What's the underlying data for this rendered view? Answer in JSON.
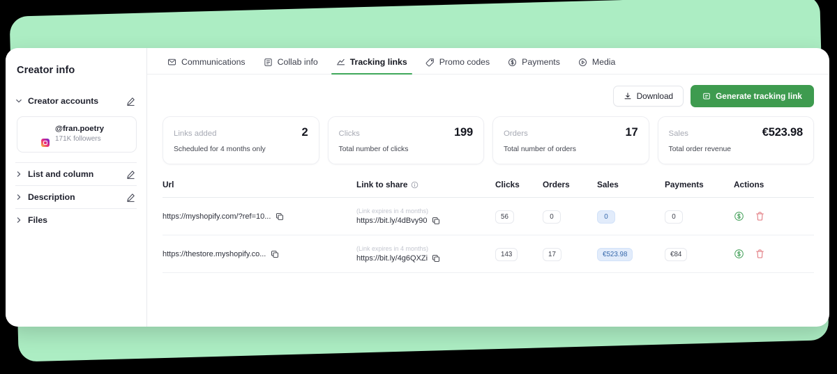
{
  "colors": {
    "backdrop_green": "#ACEDC3",
    "primary_green": "#3E9B4F",
    "tab_underline": "#3FA85A",
    "badge_blue_bg": "#E2ECFB",
    "badge_blue_text": "#3769AB",
    "pay_icon_green": "#4AA35F",
    "delete_icon_red": "#E0737A"
  },
  "sidebar": {
    "title": "Creator info",
    "sections": [
      {
        "label": "Creator accounts",
        "expanded": true,
        "chevron": "chevron-down-icon",
        "editable": true
      },
      {
        "label": "List and column",
        "expanded": false,
        "chevron": "chevron-right-icon",
        "editable": true
      },
      {
        "label": "Description",
        "expanded": false,
        "chevron": "chevron-right-icon",
        "editable": true
      },
      {
        "label": "Files",
        "expanded": false,
        "chevron": "chevron-right-icon",
        "editable": false
      }
    ],
    "account": {
      "handle": "@fran.poetry",
      "followers": "171K followers",
      "platform_icon": "instagram-icon",
      "avatar_icon": "avatar"
    }
  },
  "tabs": [
    {
      "label": "Communications",
      "icon": "chat-icon",
      "active": false
    },
    {
      "label": "Collab info",
      "icon": "document-icon",
      "active": false
    },
    {
      "label": "Tracking links",
      "icon": "trend-line-icon",
      "active": true
    },
    {
      "label": "Promo codes",
      "icon": "tag-icon",
      "active": false
    },
    {
      "label": "Payments",
      "icon": "dollar-circle-icon",
      "active": false
    },
    {
      "label": "Media",
      "icon": "play-circle-icon",
      "active": false
    }
  ],
  "toolbar": {
    "download_label": "Download",
    "download_icon": "download-icon",
    "generate_label": "Generate tracking link",
    "generate_icon": "link-generate-icon"
  },
  "stats": [
    {
      "label": "Links added",
      "value": "2",
      "sub": "Scheduled for 4 months only"
    },
    {
      "label": "Clicks",
      "value": "199",
      "sub": "Total number of clicks"
    },
    {
      "label": "Orders",
      "value": "17",
      "sub": "Total number of orders"
    },
    {
      "label": "Sales",
      "value": "€523.98",
      "sub": "Total order revenue"
    }
  ],
  "table": {
    "headers": {
      "url": "Url",
      "link_to_share": "Link to share",
      "link_to_share_info_icon": "info-icon",
      "clicks": "Clicks",
      "orders": "Orders",
      "sales": "Sales",
      "payments": "Payments",
      "actions": "Actions"
    },
    "rows": [
      {
        "url": "https://myshopify.com/?ref=10...",
        "url_copy_icon": "copy-icon",
        "expiry_note": "(Link expires in 4 months)",
        "short_link": "https://bit.ly/4dBvy90",
        "short_link_copy_icon": "copy-icon",
        "clicks": "56",
        "orders": "0",
        "sales": "0",
        "sales_highlight": true,
        "payments": "0",
        "pay_icon": "dollar-circle-icon",
        "delete_icon": "trash-icon"
      },
      {
        "url": "https://thestore.myshopify.co...",
        "url_copy_icon": "copy-icon",
        "expiry_note": "(Link expires in 4 months)",
        "short_link": "https://bit.ly/4g6QXZi",
        "short_link_copy_icon": "copy-icon",
        "clicks": "143",
        "orders": "17",
        "sales": "€523.98",
        "sales_highlight": true,
        "payments": "€84",
        "pay_icon": "dollar-circle-icon",
        "delete_icon": "trash-icon"
      }
    ]
  }
}
